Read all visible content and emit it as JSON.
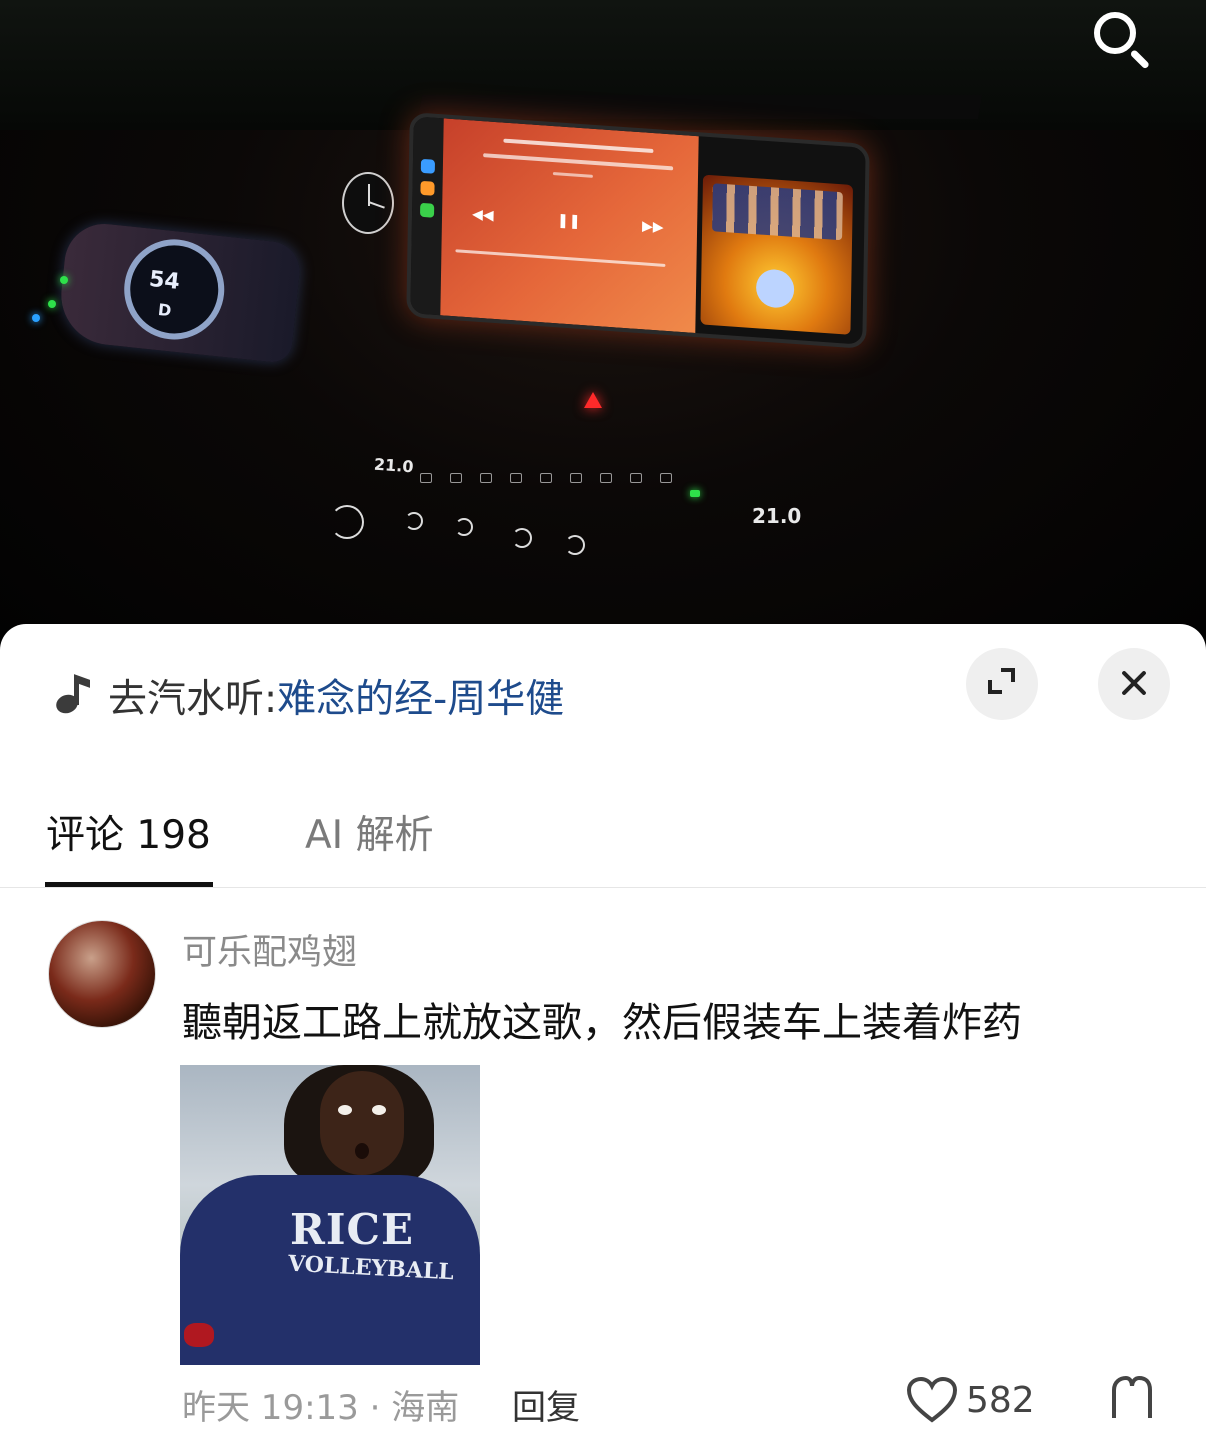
{
  "video": {
    "speed": "54",
    "gear": "D",
    "temp_left": "21.0",
    "temp_right": "21.0",
    "search_icon": "search-icon"
  },
  "music": {
    "icon": "music-note-icon",
    "prefix": "去汽水听:",
    "title": "难念的经-周华健"
  },
  "header_buttons": {
    "expand_icon": "expand-icon",
    "close_icon": "close-icon"
  },
  "tabs": [
    {
      "label": "评论 198",
      "active": true
    },
    {
      "label": "AI 解析",
      "active": false
    }
  ],
  "comment": {
    "username": "可乐配鸡翅",
    "text": "聽朝返工路上就放这歌，然后假装车上装着炸药",
    "time_location": "昨天 19:13 · 海南",
    "reply_label": "回复",
    "like_count": "582",
    "meme_shirt_line1": "RICE",
    "meme_shirt_line2": "VOLLEYBALL"
  },
  "colors": {
    "accent_link": "#1e4b8c",
    "sheet_bg": "#ffffff",
    "muted_text": "#9a9a9a"
  }
}
